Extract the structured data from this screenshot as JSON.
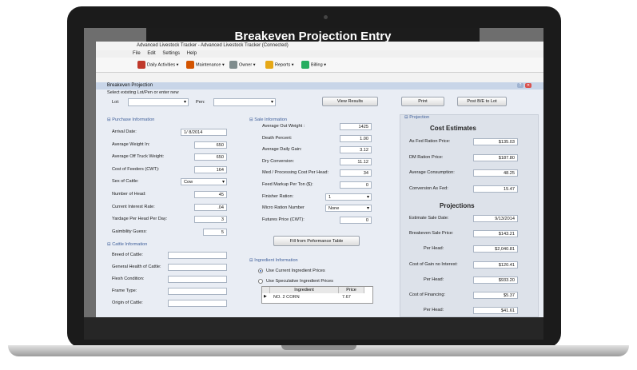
{
  "banner": {
    "title": "Breakeven Projection Entry"
  },
  "window": {
    "title": "Advanced Livestock Tracker - Advanced Livestock Tracker (Connected)"
  },
  "menu": [
    "File",
    "Edit",
    "Settings",
    "Help"
  ],
  "toolbar": [
    {
      "label": "Daily Activities",
      "icon": "calendar-icon",
      "color": "#c0392b"
    },
    {
      "label": "Maintenance",
      "icon": "wrench-icon",
      "color": "#d35400"
    },
    {
      "label": "Owner",
      "icon": "ledger-icon",
      "color": "#7f8c8d"
    },
    {
      "label": "Reports",
      "icon": "report-icon",
      "color": "#e6a817"
    },
    {
      "label": "Billing",
      "icon": "billing-icon",
      "color": "#27ae60"
    }
  ],
  "dialog": {
    "title": "Breakeven Projection",
    "select_hint": "Select existing Lot/Pen or enter new",
    "lot_label": "Lot:",
    "lot_value": "",
    "pen_label": "Pen:",
    "pen_value": "",
    "view_results": "View Results",
    "print": "Print",
    "post": "Post B/E to Lot"
  },
  "purchase": {
    "title": "Purchase Information",
    "rows": [
      {
        "label": "Arrival Date:",
        "value": "1/ 8/2014"
      },
      {
        "label": "Average Weight In:",
        "value": "650"
      },
      {
        "label": "Average Off Truck Weight:",
        "value": "650"
      },
      {
        "label": "Cost of Feeders (CWT):",
        "value": "164"
      },
      {
        "label": "Sex of Cattle:",
        "value": "Cow"
      },
      {
        "label": "Number of Head:",
        "value": "45"
      },
      {
        "label": "Current Interest Rate:",
        "value": ".04"
      },
      {
        "label": "Yardage Per Head Per Day:",
        "value": "3"
      },
      {
        "label": "Gaimbility Guess:",
        "value": "5"
      }
    ]
  },
  "cattle": {
    "title": "Cattle Information",
    "rows": [
      {
        "label": "Breed of Cattle:",
        "value": ""
      },
      {
        "label": "General Health of Cattle:",
        "value": ""
      },
      {
        "label": "Flesh Condition:",
        "value": ""
      },
      {
        "label": "Frame Type:",
        "value": ""
      },
      {
        "label": "Origin of Cattle:",
        "value": ""
      }
    ]
  },
  "sale": {
    "title": "Sale Information",
    "rows": [
      {
        "label": "Average Out Weight :",
        "value": "1425"
      },
      {
        "label": "Death Percent:",
        "value": "1.00"
      },
      {
        "label": "Average Daily Gain:",
        "value": "3.12"
      },
      {
        "label": "Dry Conversion:",
        "value": "11.12"
      },
      {
        "label": "Med / Processing Cost Per Head:",
        "value": "34"
      },
      {
        "label": "Feed Markup Per Ton ($):",
        "value": "0"
      },
      {
        "label": "Finisher Ration:",
        "value": "1"
      },
      {
        "label": "Micro Ration Number",
        "value": "None"
      },
      {
        "label": "Futures Price (CWT):",
        "value": "0"
      }
    ],
    "fill_button": "Fill from Peformance Table"
  },
  "ingredient": {
    "title": "Ingredient Information",
    "options": [
      "Use Current Ingredient Prices",
      "Use Speculative Ingredient Prices"
    ],
    "selected": 0,
    "columns": [
      "Ingredient",
      "Price"
    ],
    "rows": [
      {
        "name": "NO. 2 CORN",
        "price": "7.67"
      }
    ]
  },
  "projection": {
    "title": "Projection",
    "cost_title": "Cost Estimates",
    "cost_rows": [
      {
        "label": "As Fed Ration Price:",
        "value": "$135.03"
      },
      {
        "label": "DM Ration Price:",
        "value": "$187.80"
      },
      {
        "label": "Average Consumption:",
        "value": "48.25"
      },
      {
        "label": "Conversion As Fed:",
        "value": "15.47"
      }
    ],
    "proj_title": "Projections",
    "proj_rows": [
      {
        "label": "Estimate Sale Date:",
        "value": "9/13/2014"
      },
      {
        "label": "Breakeven Sale Price:",
        "value": "$143.21"
      },
      {
        "label": "Per Head:",
        "value": "$2,040.81"
      },
      {
        "label": "Cost of Gain no Interest:",
        "value": "$120.41"
      },
      {
        "label": "Per Head:",
        "value": "$933.20"
      },
      {
        "label": "Cost of Financing:",
        "value": "$5.37"
      },
      {
        "label": "Per Head:",
        "value": "$41.61"
      }
    ]
  }
}
